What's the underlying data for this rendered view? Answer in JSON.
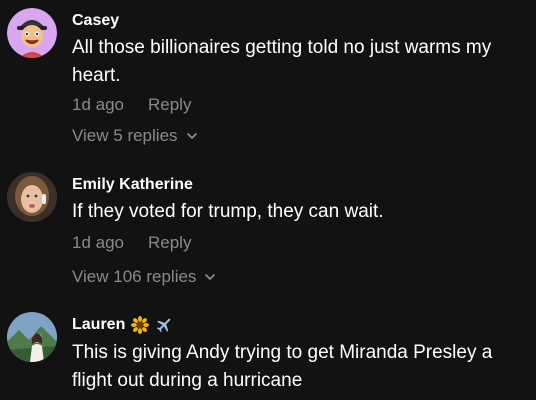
{
  "colors": {
    "background": "#121212",
    "text_primary": "#ffffff",
    "text_secondary": "#8a8a8a"
  },
  "comments": [
    {
      "username": "Casey",
      "text": "All those billionaires getting told no just warms my heart.",
      "time": "1d ago",
      "reply_label": "Reply",
      "view_replies_label": "View 5 replies",
      "avatar_icon": "cartoon-avatar",
      "username_icons": []
    },
    {
      "username": "Emily Katherine",
      "text": "If they voted for trump, they can wait.",
      "time": "1d ago",
      "reply_label": "Reply",
      "view_replies_label": "View 106 replies",
      "avatar_icon": "photo-avatar",
      "username_icons": []
    },
    {
      "username": "Lauren",
      "text": "This is giving Andy trying to get Miranda Presley a flight out during a hurricane",
      "avatar_icon": "photo-avatar",
      "username_icons": [
        "sunflower-icon",
        "airplane-icon"
      ]
    }
  ]
}
